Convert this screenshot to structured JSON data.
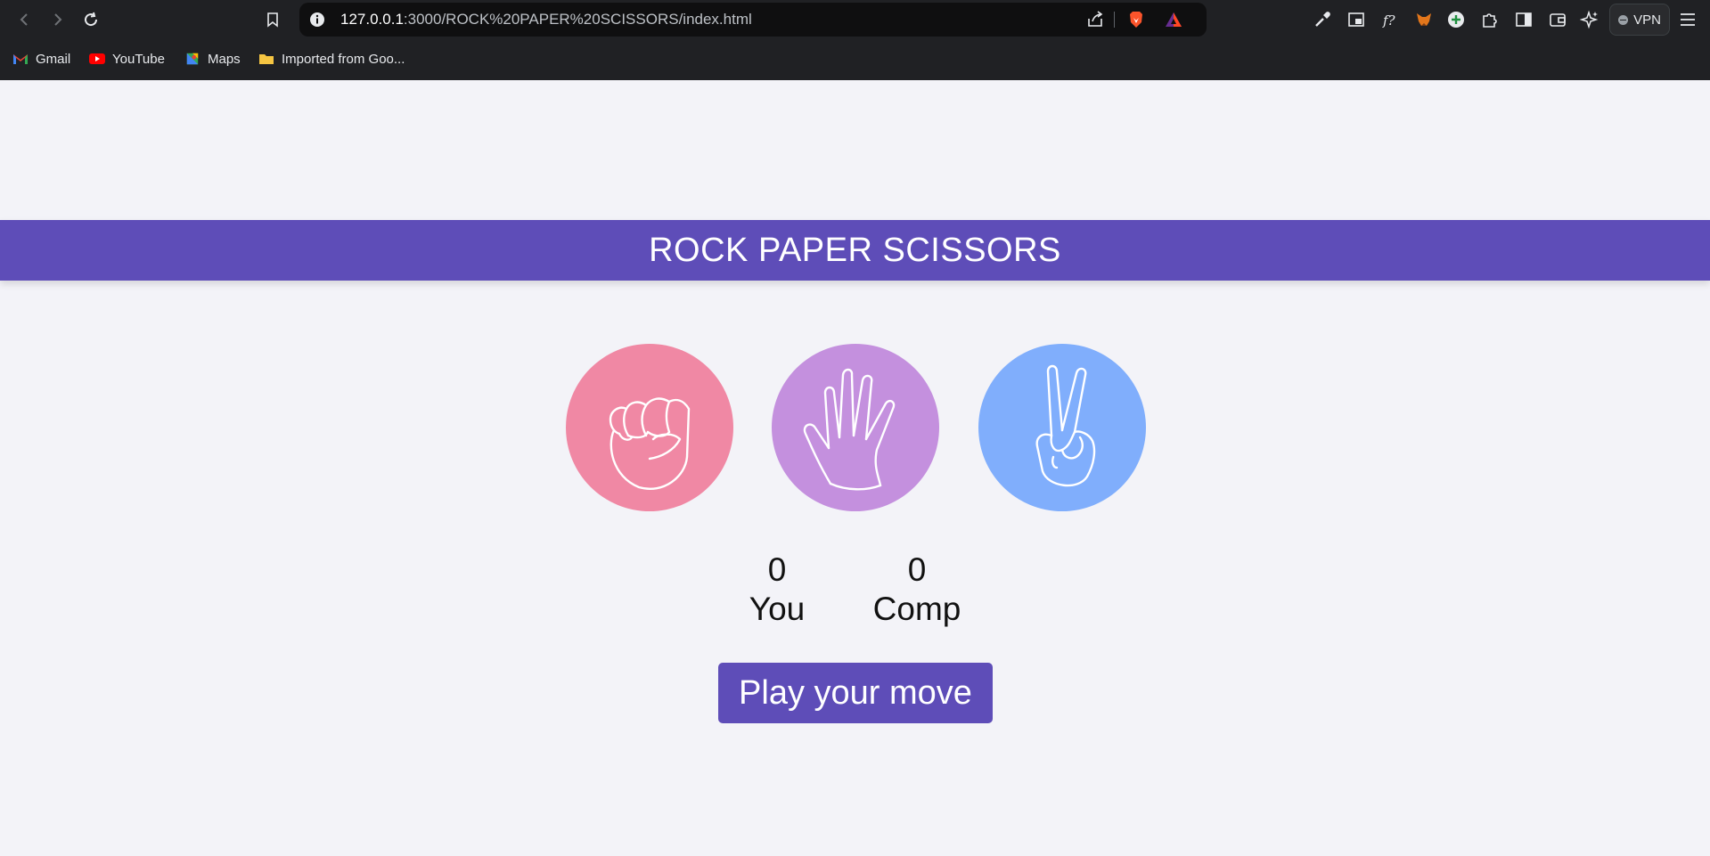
{
  "browser": {
    "url": {
      "host": "127.0.0.1",
      "path": ":3000/ROCK%20PAPER%20SCISSORS/index.html"
    },
    "vpn_label": "VPN",
    "bookmarks": [
      {
        "label": "Gmail",
        "icon": "gmail-icon"
      },
      {
        "label": "YouTube",
        "icon": "youtube-icon"
      },
      {
        "label": "Maps",
        "icon": "maps-icon"
      },
      {
        "label": "Imported from Goo...",
        "icon": "folder-icon"
      }
    ]
  },
  "page": {
    "title": "ROCK PAPER SCISSORS",
    "choices": [
      {
        "id": "rock",
        "icon": "fist-icon",
        "color": "#f088a4"
      },
      {
        "id": "paper",
        "icon": "open-hand-icon",
        "color": "#c490de"
      },
      {
        "id": "scissors",
        "icon": "peace-hand-icon",
        "color": "#80aefc"
      }
    ],
    "scores": {
      "you": {
        "value": "0",
        "label": "You"
      },
      "comp": {
        "value": "0",
        "label": "Comp"
      }
    },
    "play_button": "Play your move"
  },
  "colors": {
    "accent": "#5e4db8",
    "page_bg": "#f3f3f8",
    "chrome_bg": "#202124"
  }
}
